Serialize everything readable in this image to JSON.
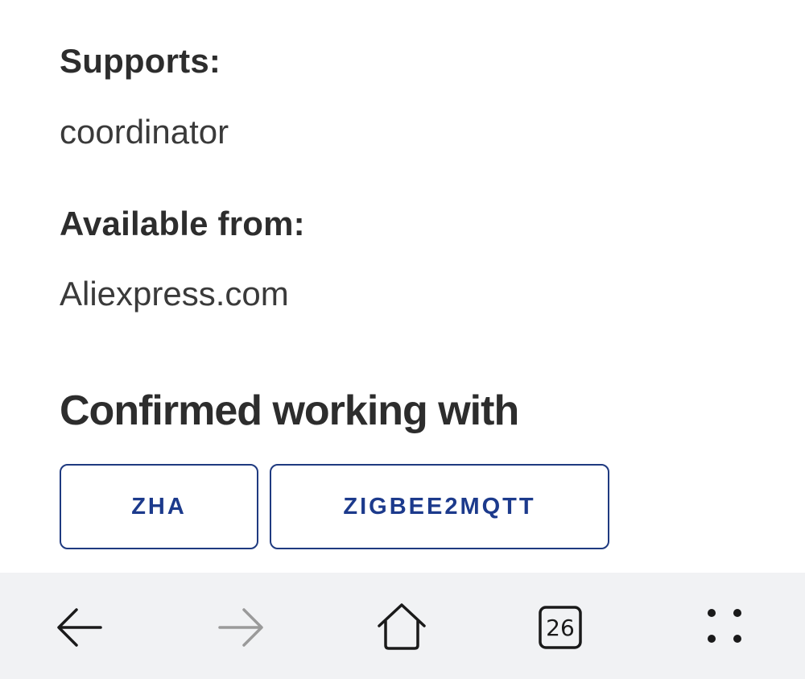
{
  "details": {
    "supports_label": "Supports:",
    "supports_value": "coordinator",
    "available_label": "Available from:",
    "available_value": "Aliexpress.com"
  },
  "compat": {
    "title": "Confirmed working with",
    "chips": [
      {
        "label": "ZHA"
      },
      {
        "label": "ZIGBEE2MQTT"
      }
    ]
  },
  "browser_bar": {
    "back_icon": "arrow-left-icon",
    "forward_icon": "arrow-right-icon",
    "home_icon": "home-icon",
    "tabs_count": "26",
    "menu_icon": "dots-menu-icon",
    "colors": {
      "bar_bg": "#f1f2f4",
      "icon_active": "#1a1a1a",
      "icon_disabled": "#9a9a9a",
      "chip_text": "#1c3a8c"
    }
  }
}
